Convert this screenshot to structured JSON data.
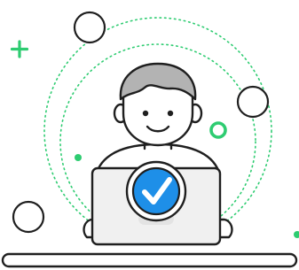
{
  "illustration": {
    "subject": "person-at-laptop-with-checkmark",
    "icons": [
      "plus-icon",
      "checkmark-badge-icon",
      "ring-icon",
      "dot-icon",
      "bubble-icon"
    ]
  },
  "colors": {
    "outline": "#1f1f1f",
    "hair": "#b3b3b3",
    "skin": "#ffffff",
    "laptop_body": "#f0f0f0",
    "laptop_shadow": "#e3e3e3",
    "badge_blue": "#1e8fe8",
    "badge_ring": "#ffffff",
    "check": "#ffffff",
    "accent_green": "#2ecc71",
    "orbit_green": "#2ecc71",
    "background": "#ffffff"
  }
}
